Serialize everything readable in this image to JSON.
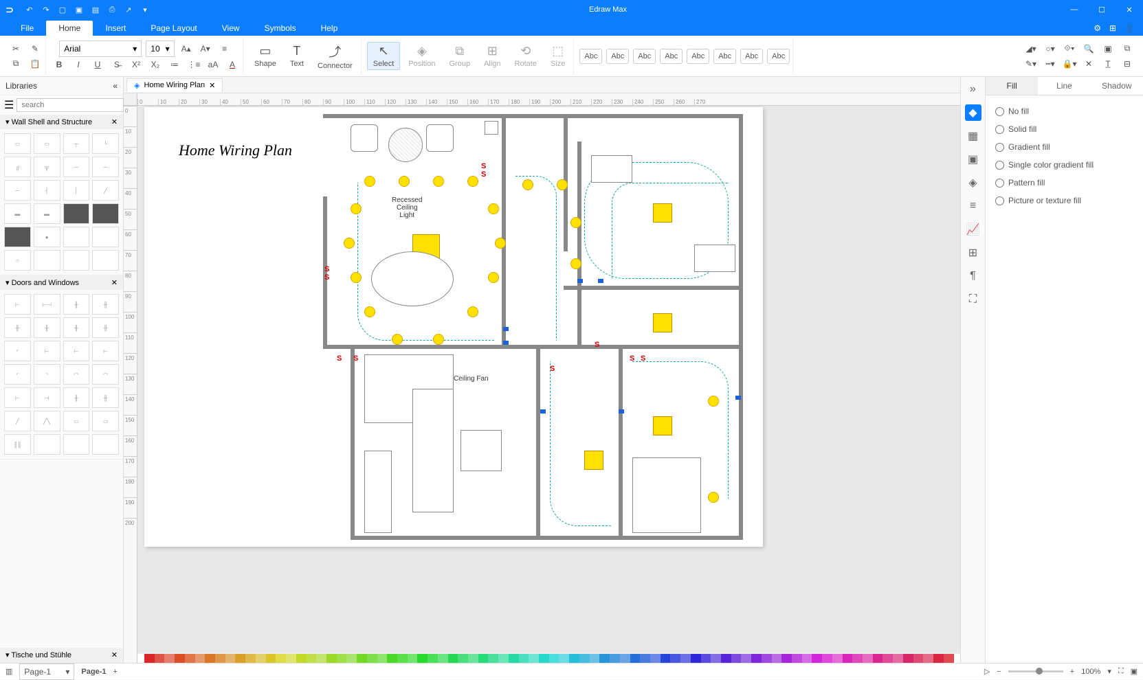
{
  "app": {
    "title": "Edraw Max"
  },
  "menu": {
    "file": "File",
    "home": "Home",
    "insert": "Insert",
    "pagelayout": "Page Layout",
    "view": "View",
    "symbols": "Symbols",
    "help": "Help"
  },
  "ribbon": {
    "font": "Arial",
    "size": "10",
    "shape": "Shape",
    "text": "Text",
    "connector": "Connector",
    "select": "Select",
    "position": "Position",
    "group": "Group",
    "align": "Align",
    "rotate": "Rotate",
    "size2": "Size",
    "abc": "Abc"
  },
  "libraries": {
    "title": "Libraries",
    "search_ph": "search",
    "sec1": "Wall Shell and Structure",
    "sec2": "Doors and Windows",
    "sec3": "Tische und Stühle"
  },
  "doc": {
    "tab": "Home Wiring Plan"
  },
  "plan": {
    "title": "Home Wiring Plan",
    "recessed": "Recessed\nCeiling\nLight",
    "light": "Light",
    "ceilingfan": "Ceiling Fan"
  },
  "rpanel": {
    "fill": "Fill",
    "line": "Line",
    "shadow": "Shadow",
    "nofill": "No fill",
    "solid": "Solid fill",
    "gradient": "Gradient fill",
    "singlegrad": "Single color gradient fill",
    "pattern": "Pattern fill",
    "picture": "Picture or texture fill"
  },
  "status": {
    "page": "Page-1",
    "pagetab": "Page-1",
    "zoom": "100%"
  },
  "ruler_h": [
    0,
    10,
    20,
    30,
    40,
    50,
    60,
    70,
    80,
    90,
    100,
    110,
    120,
    130,
    140,
    150,
    160,
    170,
    180,
    190,
    200,
    210,
    220,
    230,
    240,
    250,
    260,
    270
  ],
  "ruler_v": [
    0,
    10,
    20,
    30,
    40,
    50,
    60,
    70,
    80,
    90,
    100,
    110,
    120,
    130,
    140,
    150,
    160,
    170,
    180,
    190,
    200
  ]
}
